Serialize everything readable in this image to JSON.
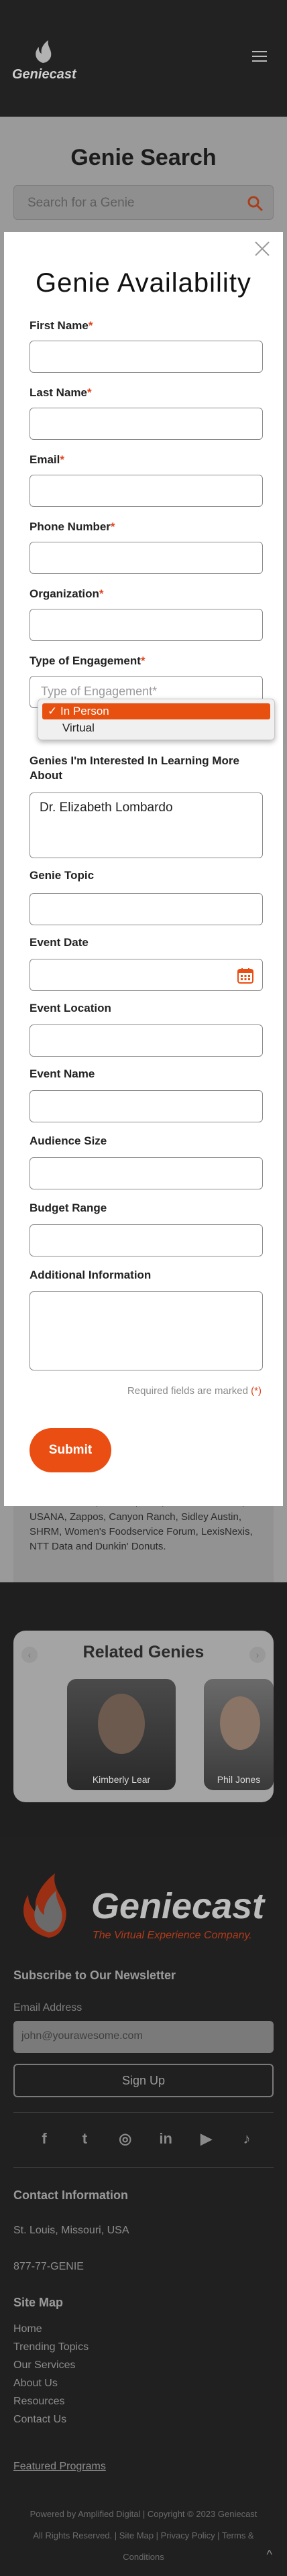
{
  "header": {
    "logo_text": "Geniecast"
  },
  "search": {
    "title": "Genie Search",
    "placeholder": "Search for a Genie"
  },
  "background_card": {
    "clients_text": "NBC Universal, Deloitte, UBS, Lincoln Financial, USANA, Zappos, Canyon Ranch, Sidley Austin, SHRM, Women's Foodservice Forum, LexisNexis, NTT Data and Dunkin' Donuts."
  },
  "related": {
    "title": "Related Genies",
    "people": [
      {
        "name": "Kimberly Lear"
      },
      {
        "name": "Phil Jones"
      }
    ]
  },
  "modal": {
    "title": "Genie Availability",
    "fields": {
      "first_name": {
        "label": "First Name",
        "required_mark": "*"
      },
      "last_name": {
        "label": "Last Name",
        "required_mark": "*"
      },
      "email": {
        "label": "Email",
        "required_mark": "*"
      },
      "phone": {
        "label": "Phone Number",
        "required_mark": "*"
      },
      "organization": {
        "label": "Organization",
        "required_mark": "*"
      },
      "engagement": {
        "label": "Type of Engagement",
        "required_mark": "*",
        "placeholder": "Type of Engagement*"
      },
      "genies": {
        "label": "Genies I'm Interested In Learning More About",
        "value": "Dr. Elizabeth Lombardo"
      },
      "topic": {
        "label": "Genie Topic"
      },
      "event_date": {
        "label": "Event Date"
      },
      "event_location": {
        "label": "Event Location"
      },
      "event_name": {
        "label": "Event Name"
      },
      "audience_size": {
        "label": "Audience Size"
      },
      "budget_range": {
        "label": "Budget Range"
      },
      "additional_info": {
        "label": "Additional Information"
      }
    },
    "dropdown_options": [
      {
        "label": "In Person",
        "selected": true
      },
      {
        "label": "Virtual",
        "selected": false
      }
    ],
    "required_note": "Required fields are marked",
    "required_note_mark": "(*)",
    "submit_label": "Submit"
  },
  "footer": {
    "logo_text": "Geniecast",
    "tagline": "The Virtual Experience Company.",
    "newsletter_title": "Subscribe to Our Newsletter",
    "email_label": "Email Address",
    "email_placeholder": "john@yourawesome.com",
    "signup_label": "Sign Up",
    "socials": [
      "facebook-icon",
      "twitter-icon",
      "instagram-icon",
      "linkedin-icon",
      "youtube-icon",
      "tiktok-icon"
    ],
    "contact_title": "Contact Information",
    "city": "St. Louis, Missouri, USA",
    "phone": "877-77-GENIE",
    "sitemap_title": "Site Map",
    "sitemap_links": [
      "Home",
      "Trending Topics",
      "Our Services",
      "About Us",
      "Resources",
      "Contact Us"
    ],
    "featured_link": "Featured Programs",
    "copyright_line1": "Powered by Amplified Digital | Copyright © 2023 Geniecast",
    "copyright_line2": "All Rights Reserved. | Site Map | Privacy Policy | Terms &",
    "copyright_line3": "Conditions"
  },
  "colors": {
    "accent": "#ea4e12",
    "required": "#e2421c",
    "footer_bg": "#202020"
  }
}
